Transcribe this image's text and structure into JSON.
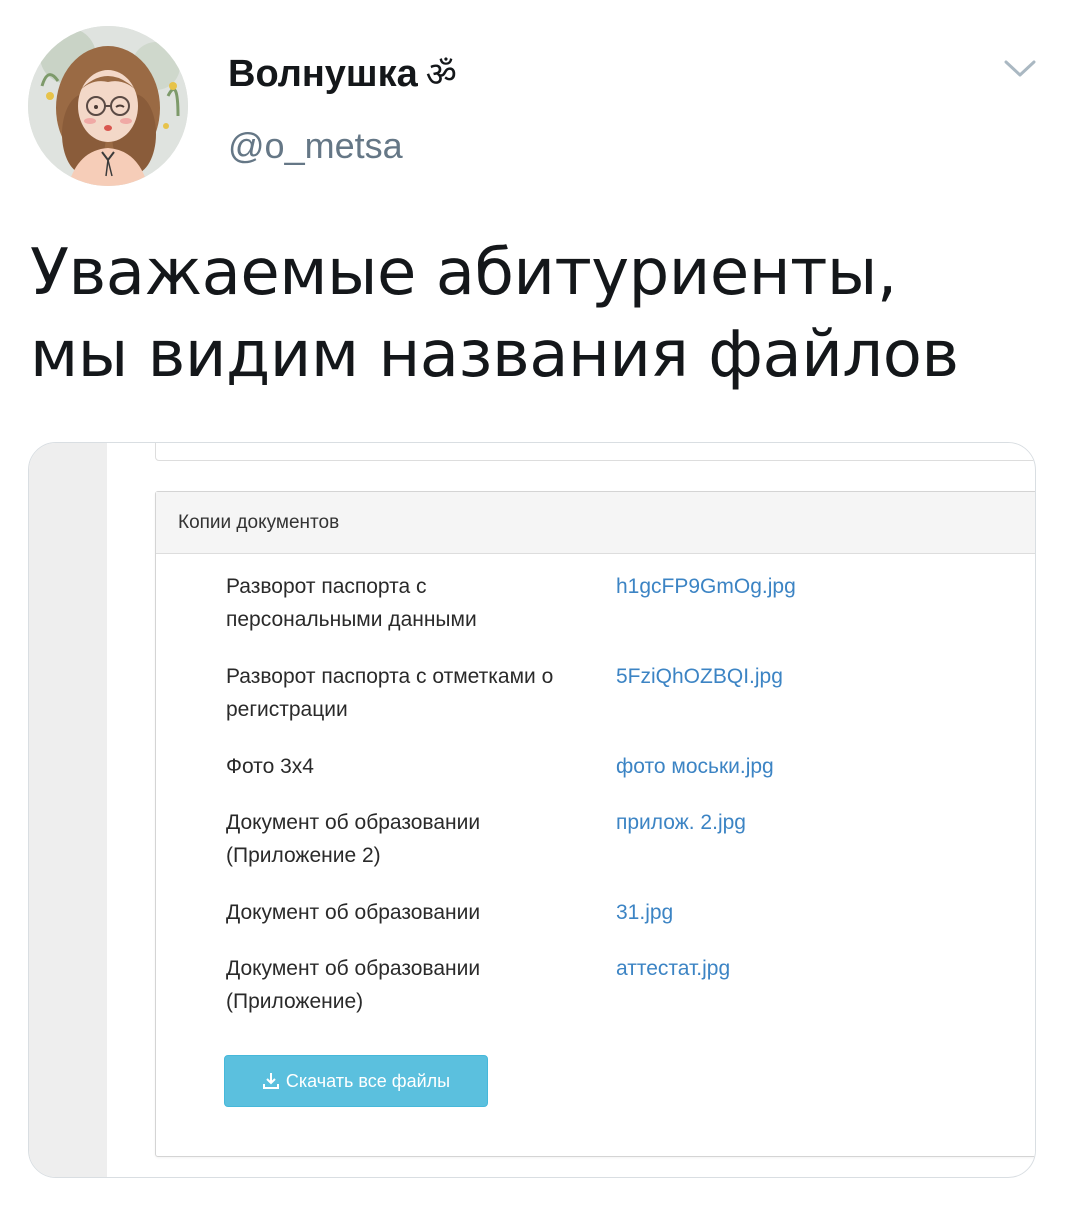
{
  "tweet": {
    "display_name": "Волнушка",
    "name_emoji": "ॐ",
    "handle": "@o_metsa",
    "text": "Уважаемые абитуриенты, мы видим названия файлов",
    "avatar_icon": "avatar-illustration-icon",
    "caret_icon": "chevron-down-icon"
  },
  "screenshot": {
    "panel_title": "Копии документов",
    "documents": [
      {
        "label": "Разворот паспорта с персональными данными",
        "file": "h1gcFP9GmOg.jpg"
      },
      {
        "label": "Разворот паспорта с отметками о регистрации",
        "file": "5FziQhOZBQI.jpg"
      },
      {
        "label": "Фото 3x4",
        "file": "фото моськи.jpg"
      },
      {
        "label": "Документ об образовании (Приложение 2)",
        "file": "прилож. 2.jpg"
      },
      {
        "label": "Документ об образовании",
        "file": "31.jpg"
      },
      {
        "label": "Документ об образовании (Приложение)",
        "file": "аттестат.jpg"
      }
    ],
    "download_button": "Скачать все файлы",
    "download_icon": "download-icon",
    "colors": {
      "link": "#3c84c4",
      "button": "#5bc0de",
      "heading_bg": "#f5f5f5"
    }
  }
}
